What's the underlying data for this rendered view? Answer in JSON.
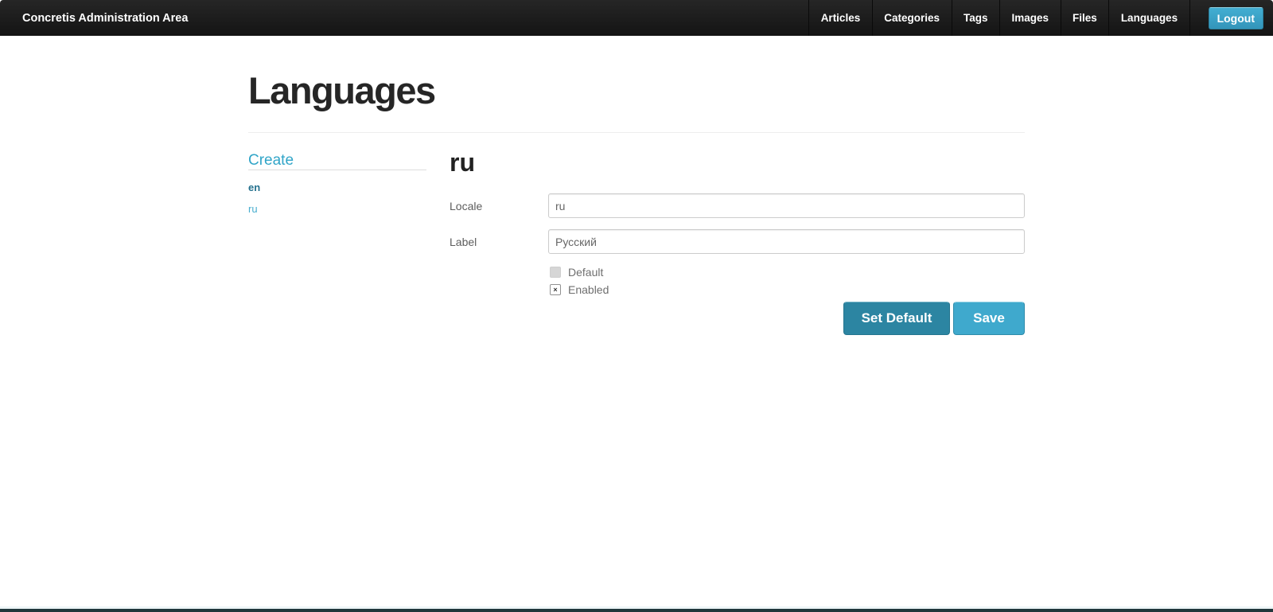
{
  "navbar": {
    "brand": "Concretis Administration Area",
    "items": [
      "Articles",
      "Categories",
      "Tags",
      "Images",
      "Files",
      "Languages"
    ],
    "logout_label": "Logout"
  },
  "page": {
    "title": "Languages"
  },
  "sidebar": {
    "create_label": "Create",
    "items": [
      {
        "label": "en"
      },
      {
        "label": "ru"
      }
    ]
  },
  "form": {
    "heading": "ru",
    "fields": [
      {
        "label": "Locale",
        "value": "ru"
      },
      {
        "label": "Label",
        "value": "Русский"
      }
    ],
    "checkboxes": [
      {
        "label": "Default",
        "checked": false,
        "disabled": true,
        "mark": ""
      },
      {
        "label": "Enabled",
        "checked": true,
        "disabled": false,
        "mark": "×"
      }
    ],
    "buttons": {
      "set_default": "Set Default",
      "save": "Save"
    }
  },
  "colors": {
    "accent": "#31A5C8",
    "navbar_bg": "#1B1B1B",
    "logout_button": "#3AA3C6",
    "set_default_button": "#2C85A2",
    "save_button": "#3FA9CD"
  }
}
